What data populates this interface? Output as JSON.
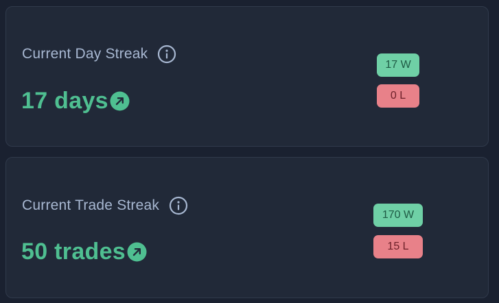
{
  "streaks": [
    {
      "title": "Current Day Streak",
      "value": "17 days",
      "wins_label": "17 W",
      "losses_label": "0 L"
    },
    {
      "title": "Current Trade Streak",
      "value": "50 trades",
      "wins_label": "170 W",
      "losses_label": "15 L"
    }
  ],
  "colors": {
    "background": "#1a2130",
    "card": "#212938",
    "title": "#a8b8d2",
    "positive": "#4fbf91",
    "win_badge": "#6fd0a6",
    "loss_badge": "#e88189"
  },
  "icons": {
    "info": "info-icon",
    "trend": "arrow-up-right-icon"
  }
}
